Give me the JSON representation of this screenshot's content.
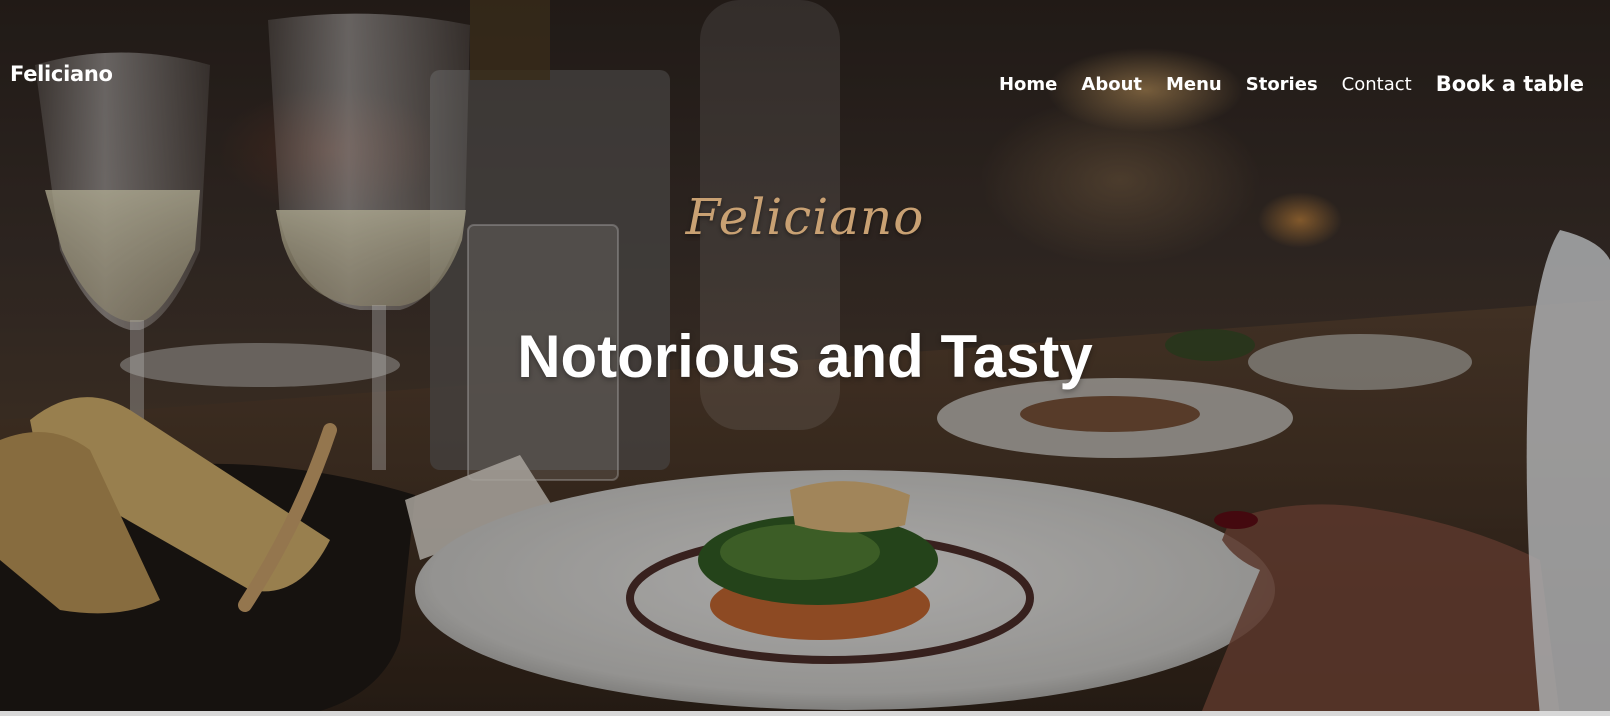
{
  "header": {
    "brand": "Feliciano",
    "nav": [
      {
        "label": "Home"
      },
      {
        "label": "About"
      },
      {
        "label": "Menu"
      },
      {
        "label": "Stories"
      },
      {
        "label": "Contact"
      },
      {
        "label": "Book a table"
      }
    ]
  },
  "hero": {
    "script_title": "Feliciano",
    "title": "Notorious and Tasty",
    "image_subject": "restaurant-dinner-table-photo"
  },
  "colors": {
    "accent_gold": "#c9a173",
    "text_white": "#ffffff"
  }
}
